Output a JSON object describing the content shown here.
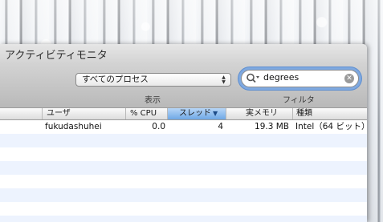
{
  "window": {
    "title": "アクティビティモニタ"
  },
  "toolbar": {
    "process_filter": {
      "selected": "すべてのプロセス",
      "icon": "updown-arrows-icon"
    },
    "show_label": "表示",
    "search": {
      "value": "degrees",
      "icon": "magnifier-icon",
      "clear_icon": "clear-icon"
    },
    "filter_label": "フィルタ"
  },
  "table": {
    "columns": [
      {
        "label": "ユーザ"
      },
      {
        "label": "% CPU"
      },
      {
        "label": "スレッド",
        "sorted": true,
        "sort_icon": "▼"
      },
      {
        "label": "実メモリ"
      },
      {
        "label": "種類"
      }
    ],
    "rows": [
      {
        "user": "fukudashuhei",
        "cpu": "0.0",
        "threads": "4",
        "memory": "19.3 MB",
        "kind": "Intel（64 ビット）"
      }
    ]
  },
  "colors": {
    "sorted_header": "#6fa8e6",
    "stripe": "#edf3fe",
    "search_focus": "#7fa9e0"
  }
}
